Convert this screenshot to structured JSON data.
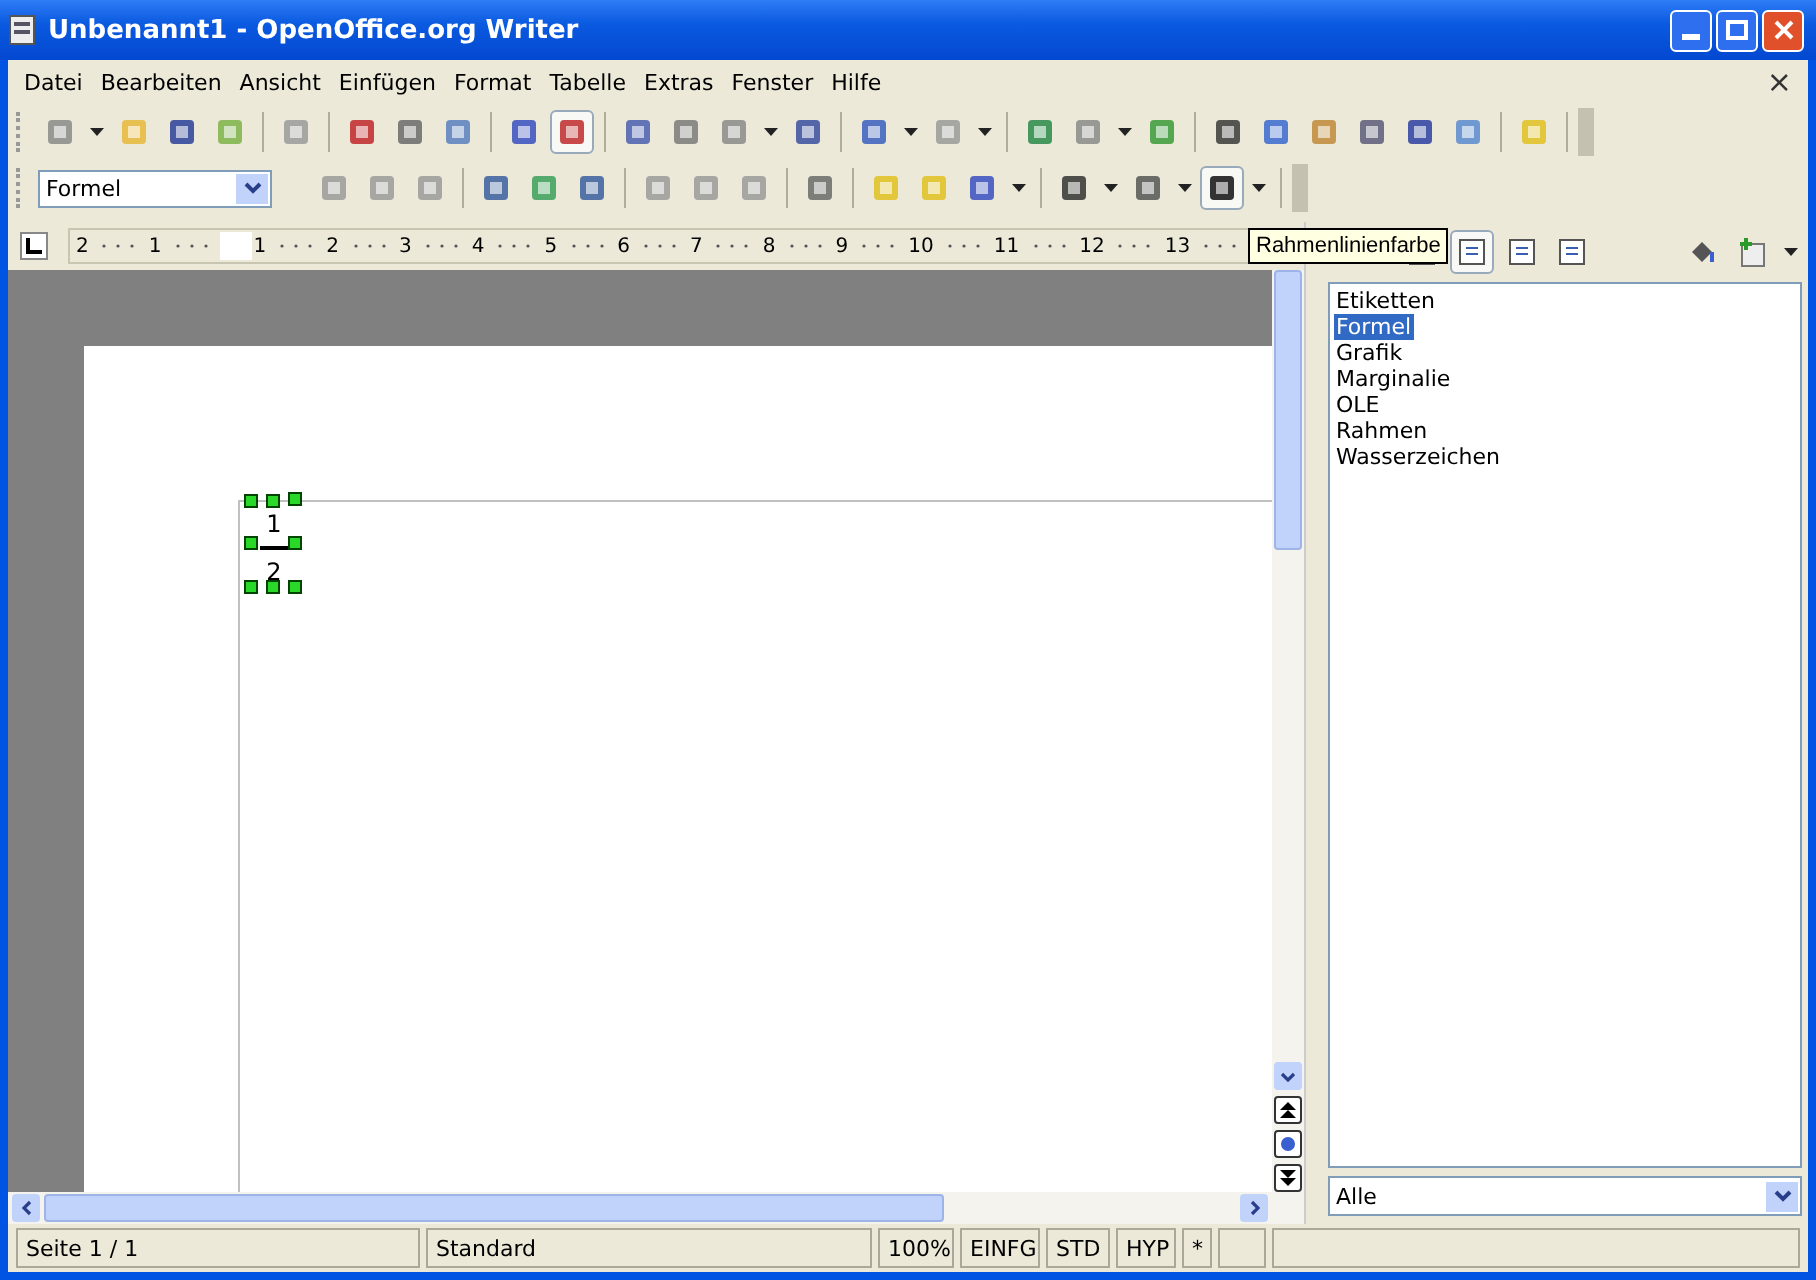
{
  "window": {
    "title": "Unbenannt1 - OpenOffice.org Writer"
  },
  "menu": [
    {
      "label": "Datei"
    },
    {
      "label": "Bearbeiten"
    },
    {
      "label": "Ansicht"
    },
    {
      "label": "Einfügen"
    },
    {
      "label": "Format"
    },
    {
      "label": "Tabelle"
    },
    {
      "label": "Extras"
    },
    {
      "label": "Fenster"
    },
    {
      "label": "Hilfe"
    }
  ],
  "close_document": "×",
  "frame_style_box": {
    "value": "Formel"
  },
  "ruler": {
    "labels": [
      "2",
      "1",
      "1",
      "2",
      "3",
      "4",
      "5",
      "6",
      "7",
      "8",
      "9",
      "10",
      "11",
      "12",
      "13"
    ]
  },
  "tooltip": "Rahmenlinienfarbe",
  "formula": {
    "numerator": "1",
    "denominator": "2"
  },
  "stylist": {
    "items": [
      {
        "label": "Etiketten",
        "selected": false
      },
      {
        "label": "Formel",
        "selected": true
      },
      {
        "label": "Grafik",
        "selected": false
      },
      {
        "label": "Marginalie",
        "selected": false
      },
      {
        "label": "OLE",
        "selected": false
      },
      {
        "label": "Rahmen",
        "selected": false
      },
      {
        "label": "Wasserzeichen",
        "selected": false
      }
    ],
    "filter": "Alle"
  },
  "status_bar": [
    "Seite 1 / 1",
    "Standard",
    "100%",
    "EINFG",
    "STD",
    "HYP",
    "*"
  ]
}
